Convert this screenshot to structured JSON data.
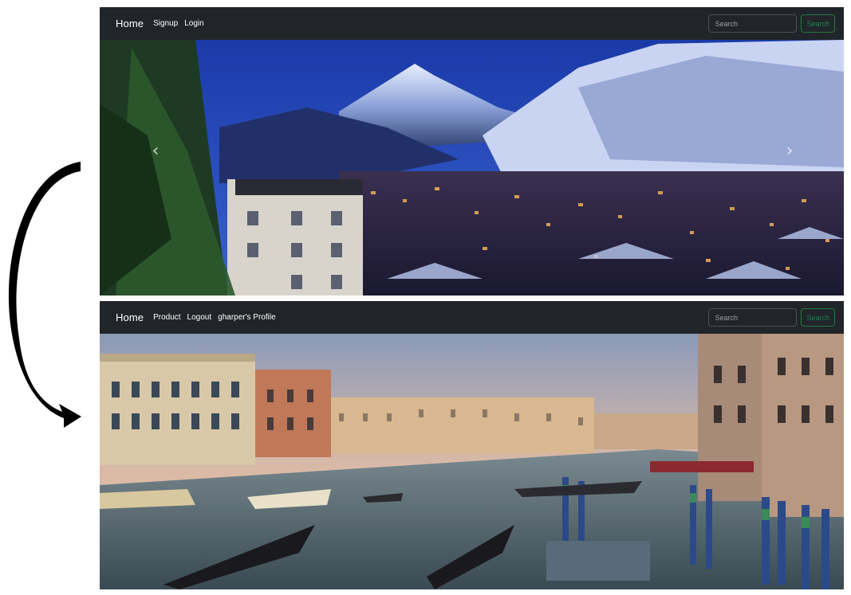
{
  "arrow": {
    "icon": "curved-arrow-down-icon"
  },
  "before": {
    "navbar": {
      "brand": "Home",
      "links": [
        "Signup",
        "Login"
      ],
      "search_placeholder": "Search",
      "search_button": "Search"
    },
    "carousel": {
      "prev_icon": "chevron-left-icon",
      "next_icon": "chevron-right-icon",
      "prev_glyph": "‹",
      "next_glyph": "›"
    }
  },
  "after": {
    "navbar": {
      "brand": "Home",
      "links": [
        "Product",
        "Logout",
        "gharper's Profile"
      ],
      "search_placeholder": "Search",
      "search_button": "Search"
    }
  },
  "colors": {
    "navbar_bg": "#212529",
    "success_green": "#198754"
  }
}
